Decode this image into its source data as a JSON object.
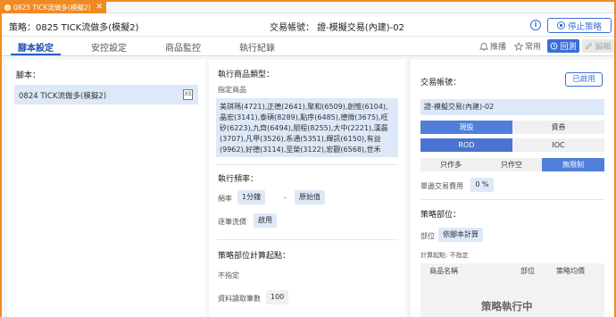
{
  "window": {
    "tab_title": "0825 TICK流做多(模擬2)",
    "close_glyph": "✕"
  },
  "header": {
    "strategy": "策略：0825 TICK流做多(模擬2)",
    "account": "交易帳號：   證-模擬交易(內建)-02",
    "info_glyph": "i",
    "stop_label": "停止策略"
  },
  "tabs": [
    "腳本設定",
    "安控設定",
    "商品監控",
    "執行紀錄"
  ],
  "toolbar": {
    "push": "推播",
    "favorite": "常用",
    "replay": "回測",
    "edit": "編輯"
  },
  "col1": {
    "script_label": "腳本：",
    "script_name": "0824 TICK流做多(模擬2)",
    "xls_glyph": "XS"
  },
  "col2": {
    "product_type_label": "執行商品類型：",
    "product_mode": "指定商品",
    "products": "美琪瑪(4721),正德(2641),聚和(6509),創惟(6104),晶宏(3141),泰碩(8289),點序(6485),德微(3675),旺矽(6223),九齊(6494),朋程(8255),大中(2221),漢磊(3707),凡甲(3526),系通(5351),輝訊(6150),有益(9962),好德(3114),至榮(3122),宏觀(6568),世禾(3…",
    "freq_label": "執行頻率：",
    "freq_key": "頻率",
    "freq_value": "1分鐘",
    "freq_dash": "-",
    "freq_mode": "原始值",
    "tick_key": "逐筆洗價",
    "tick_value": "啟用",
    "calc_label": "策略部位計算起點：",
    "calc_value": "不指定",
    "read_key": "資料讀取筆數",
    "read_value": "100"
  },
  "col3": {
    "account_label": "交易帳號：",
    "enabled_btn": "已啟用",
    "account_value": "證-模擬交易(內建)-02",
    "seg1": [
      "現股",
      "資券"
    ],
    "seg2": [
      "ROD",
      "IOC"
    ],
    "seg3": [
      "只作多",
      "只作空",
      "無限制"
    ],
    "fee_key": "單邊交易費用",
    "fee_value": "0 %",
    "position_label": "策略部位：",
    "pos_key": "部位",
    "pos_value": "依腳本計算",
    "calc_start": "計算起點: 不指定",
    "table_cols": [
      "商品名稱",
      "部位",
      "策略均價"
    ],
    "running": "策略執行中"
  },
  "colors": {
    "accent": "#3a6fd8",
    "window_border": "#f08a24",
    "selected_bg": "#dde8f8"
  }
}
